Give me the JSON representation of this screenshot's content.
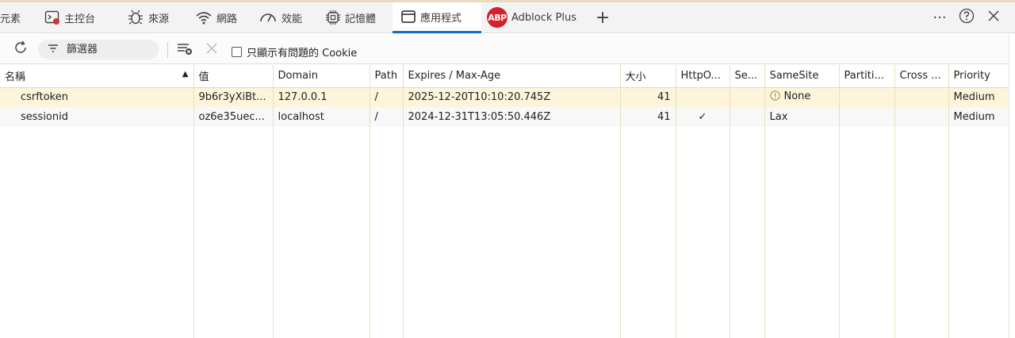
{
  "tabs": [
    {
      "label": "元素",
      "icon": "elements-icon"
    },
    {
      "label": "主控台",
      "icon": "console-icon"
    },
    {
      "label": "來源",
      "icon": "bug-icon"
    },
    {
      "label": "網路",
      "icon": "wifi-icon"
    },
    {
      "label": "效能",
      "icon": "performance-icon"
    },
    {
      "label": "記憶體",
      "icon": "memory-chip-icon"
    },
    {
      "label": "應用程式",
      "icon": "application-window-icon"
    },
    {
      "label": "Adblock Plus",
      "icon": "abp-icon",
      "badge": "ABP"
    }
  ],
  "active_tab": "應用程式",
  "toolbar": {
    "filter_placeholder": "篩選器",
    "issues_only_label": "只顯示有問題的 Cookie"
  },
  "table": {
    "columns": [
      "名稱",
      "值",
      "Domain",
      "Path",
      "Expires / Max-Age",
      "大小",
      "HttpO...",
      "Se...",
      "SameSite",
      "Partiti...",
      "Cross ...",
      "Priority"
    ],
    "rows": [
      {
        "name": "csrftoken",
        "value": "9b6r3yXiBt...",
        "domain": "127.0.0.1",
        "path": "/",
        "expires": "2025-12-20T10:10:20.745Z",
        "size": "41",
        "httponly": "",
        "secure": "",
        "samesite": "None",
        "partition": "",
        "cross": "",
        "priority": "Medium"
      },
      {
        "name": "sessionid",
        "value": "oz6e35uec...",
        "domain": "localhost",
        "path": "/",
        "expires": "2024-12-31T13:05:50.446Z",
        "size": "41",
        "httponly": "✓",
        "secure": "",
        "samesite": "Lax",
        "partition": "",
        "cross": "",
        "priority": "Medium"
      }
    ]
  },
  "colors": {
    "accent": "#0f6cbd",
    "abp_red": "#d8202b",
    "row_highlight": "#fcf5dc"
  }
}
